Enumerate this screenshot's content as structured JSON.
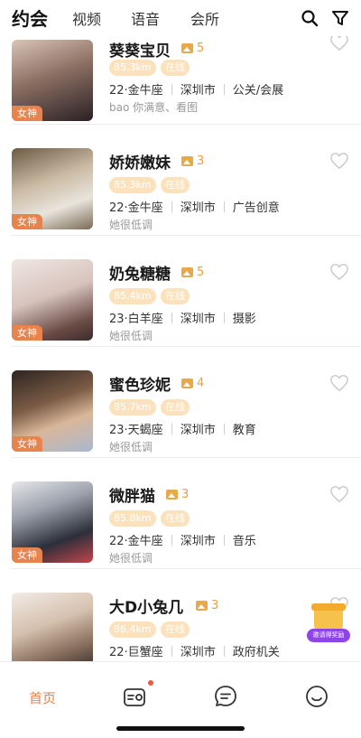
{
  "topnav": {
    "tabs": [
      {
        "label": "约会"
      },
      {
        "label": "视频"
      },
      {
        "label": "语音"
      },
      {
        "label": "会所"
      }
    ]
  },
  "badge_label": "女神",
  "list": [
    {
      "name": "葵葵宝贝",
      "pic_count": "5",
      "distance": "85.3km",
      "status": "在线",
      "age_sign": "22·金牛座",
      "city": "深圳市",
      "job": "公关/会展",
      "bio": "bao 你满意、看图"
    },
    {
      "name": "娇娇嫩妹",
      "pic_count": "3",
      "distance": "85.3km",
      "status": "在线",
      "age_sign": "22·金牛座",
      "city": "深圳市",
      "job": "广告创意",
      "bio": "她很低调"
    },
    {
      "name": "奶兔糖糖",
      "pic_count": "5",
      "distance": "85.4km",
      "status": "在线",
      "age_sign": "23·白羊座",
      "city": "深圳市",
      "job": "摄影",
      "bio": "她很低调"
    },
    {
      "name": "蜜色珍妮",
      "pic_count": "4",
      "distance": "85.7km",
      "status": "在线",
      "age_sign": "23·天蝎座",
      "city": "深圳市",
      "job": "教育",
      "bio": "她很低调"
    },
    {
      "name": "微胖猫",
      "pic_count": "3",
      "distance": "85.8km",
      "status": "在线",
      "age_sign": "22·金牛座",
      "city": "深圳市",
      "job": "音乐",
      "bio": "她很低调"
    },
    {
      "name": "大D小兔几",
      "pic_count": "3",
      "distance": "86.4km",
      "status": "在线",
      "age_sign": "22·巨蟹座",
      "city": "深圳市",
      "job": "政府机关",
      "bio": ""
    }
  ],
  "invite": {
    "label": "邀请得奖励"
  },
  "bottombar": {
    "home_label": "首页"
  },
  "colors": {
    "accent": "#e8834e",
    "pill_bg": "#fbe2bd",
    "pic_icon": "#e8a94a"
  }
}
